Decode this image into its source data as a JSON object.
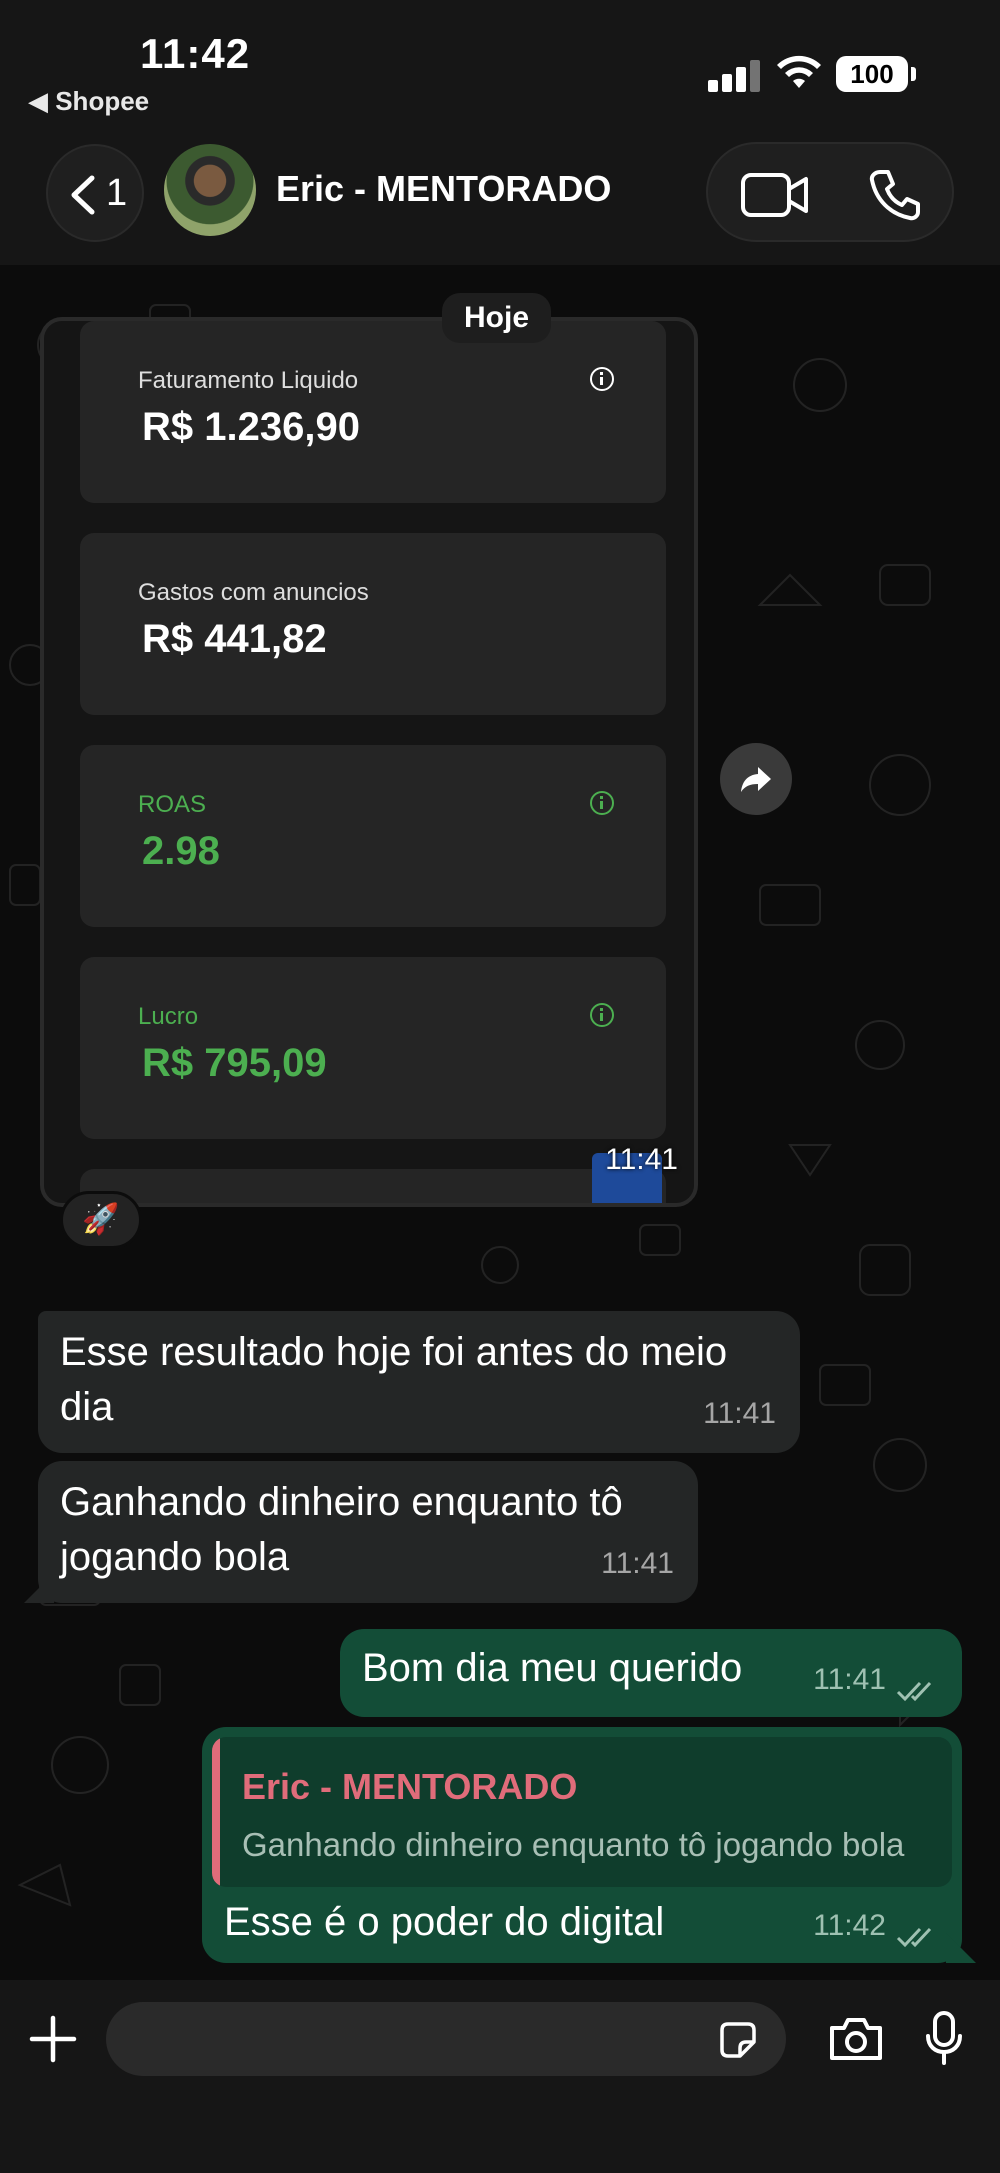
{
  "status_bar": {
    "time": "11:42",
    "back_app": "◀ Shopee",
    "battery": "100"
  },
  "header": {
    "back_count": "1",
    "contact_name": "Eric - MENTORADO"
  },
  "chat": {
    "date_label": "Hoje",
    "image_message": {
      "cards": [
        {
          "label": "Faturamento Liquido",
          "value": "R$ 1.236,90",
          "info": true,
          "color": "#ffffff"
        },
        {
          "label": "Gastos com anuncios",
          "value": "R$ 441,82",
          "info": false,
          "color": "#ffffff"
        },
        {
          "label": "ROAS",
          "value": "2.98",
          "info": true,
          "color": "#4caf50"
        },
        {
          "label": "Lucro",
          "value": "R$ 795,09",
          "info": true,
          "color": "#4caf50"
        }
      ],
      "time": "11:41",
      "reaction": "🚀"
    },
    "messages": [
      {
        "direction": "in",
        "text": "Esse resultado hoje foi antes do meio dia",
        "time": "11:41"
      },
      {
        "direction": "in",
        "text": "Ganhando dinheiro enquanto tô jogando bola",
        "time": "11:41"
      },
      {
        "direction": "out",
        "text": "Bom dia meu querido",
        "time": "11:41",
        "read": true
      },
      {
        "direction": "out",
        "quote_author": "Eric - MENTORADO",
        "quote_text": "Ganhando dinheiro enquanto tô jogando bola",
        "text": "Esse é o poder do digital",
        "time": "11:42",
        "read": true
      }
    ]
  },
  "input_bar": {
    "placeholder": ""
  },
  "colors": {
    "outgoing_bubble": "#134d37",
    "incoming_bubble": "#242626",
    "accent_green": "#4caf50",
    "quote_author": "#e06c7a"
  }
}
